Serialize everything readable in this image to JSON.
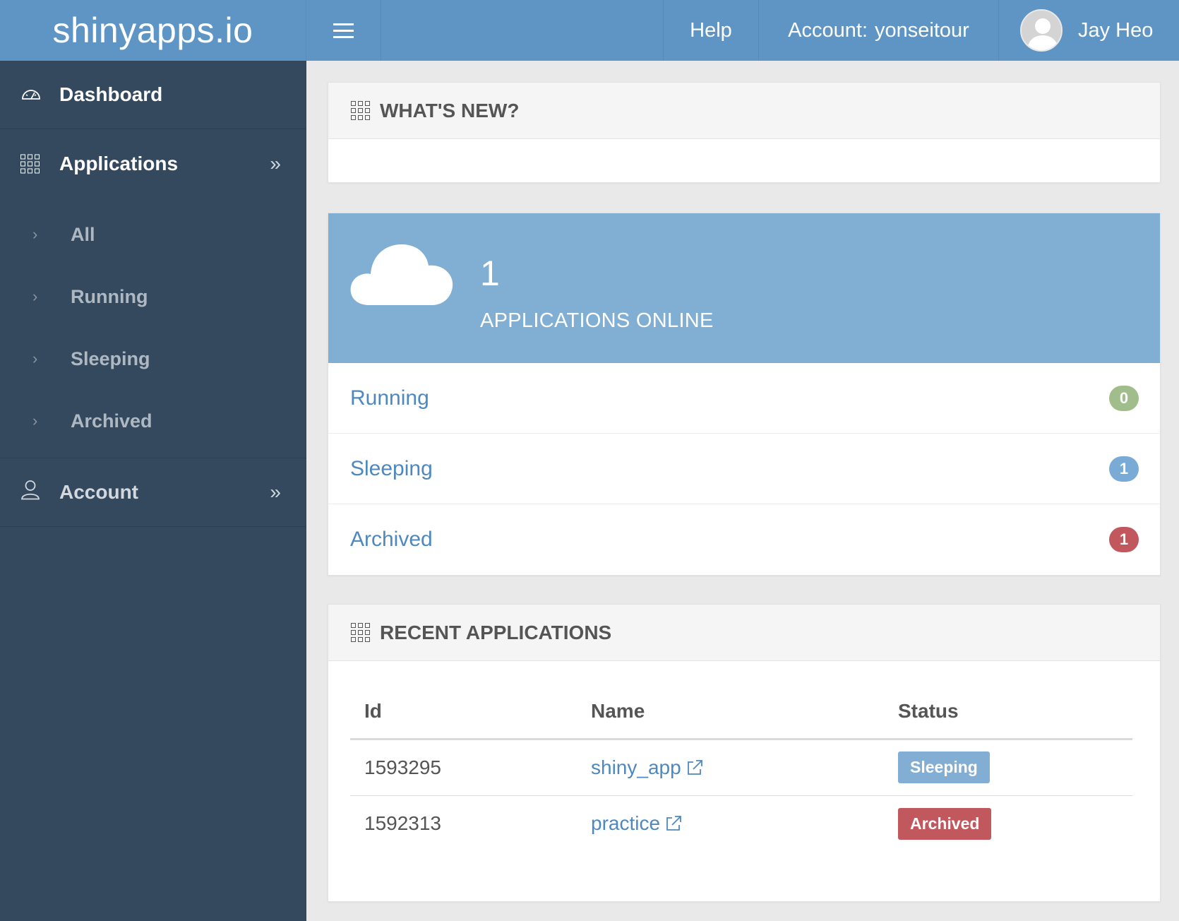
{
  "topbar": {
    "brand": "shinyapps.io",
    "help": "Help",
    "account_label": "Account:",
    "account_name": "yonseitour",
    "user_name": "Jay Heo",
    "color": "#5e95c5"
  },
  "sidebar": {
    "dashboard": "Dashboard",
    "applications": "Applications",
    "sub_items": [
      "All",
      "Running",
      "Sleeping",
      "Archived"
    ],
    "account": "Account",
    "color": "#34495e"
  },
  "whats_new": {
    "title": "WHAT'S NEW?"
  },
  "stats": {
    "count": "1",
    "label": "APPLICATIONS ONLINE",
    "rows": [
      {
        "label": "Running",
        "count": "0",
        "color": "#a1bd8b"
      },
      {
        "label": "Sleeping",
        "count": "1",
        "color": "#7aaad6"
      },
      {
        "label": "Archived",
        "count": "1",
        "color": "#c0585e"
      }
    ]
  },
  "recent": {
    "title": "RECENT APPLICATIONS",
    "columns": [
      "Id",
      "Name",
      "Status"
    ],
    "rows": [
      {
        "id": "1593295",
        "name": "shiny_app",
        "status": "Sleeping",
        "status_color": "#82aed4"
      },
      {
        "id": "1592313",
        "name": "practice",
        "status": "Archived",
        "status_color": "#c0585e"
      }
    ]
  }
}
